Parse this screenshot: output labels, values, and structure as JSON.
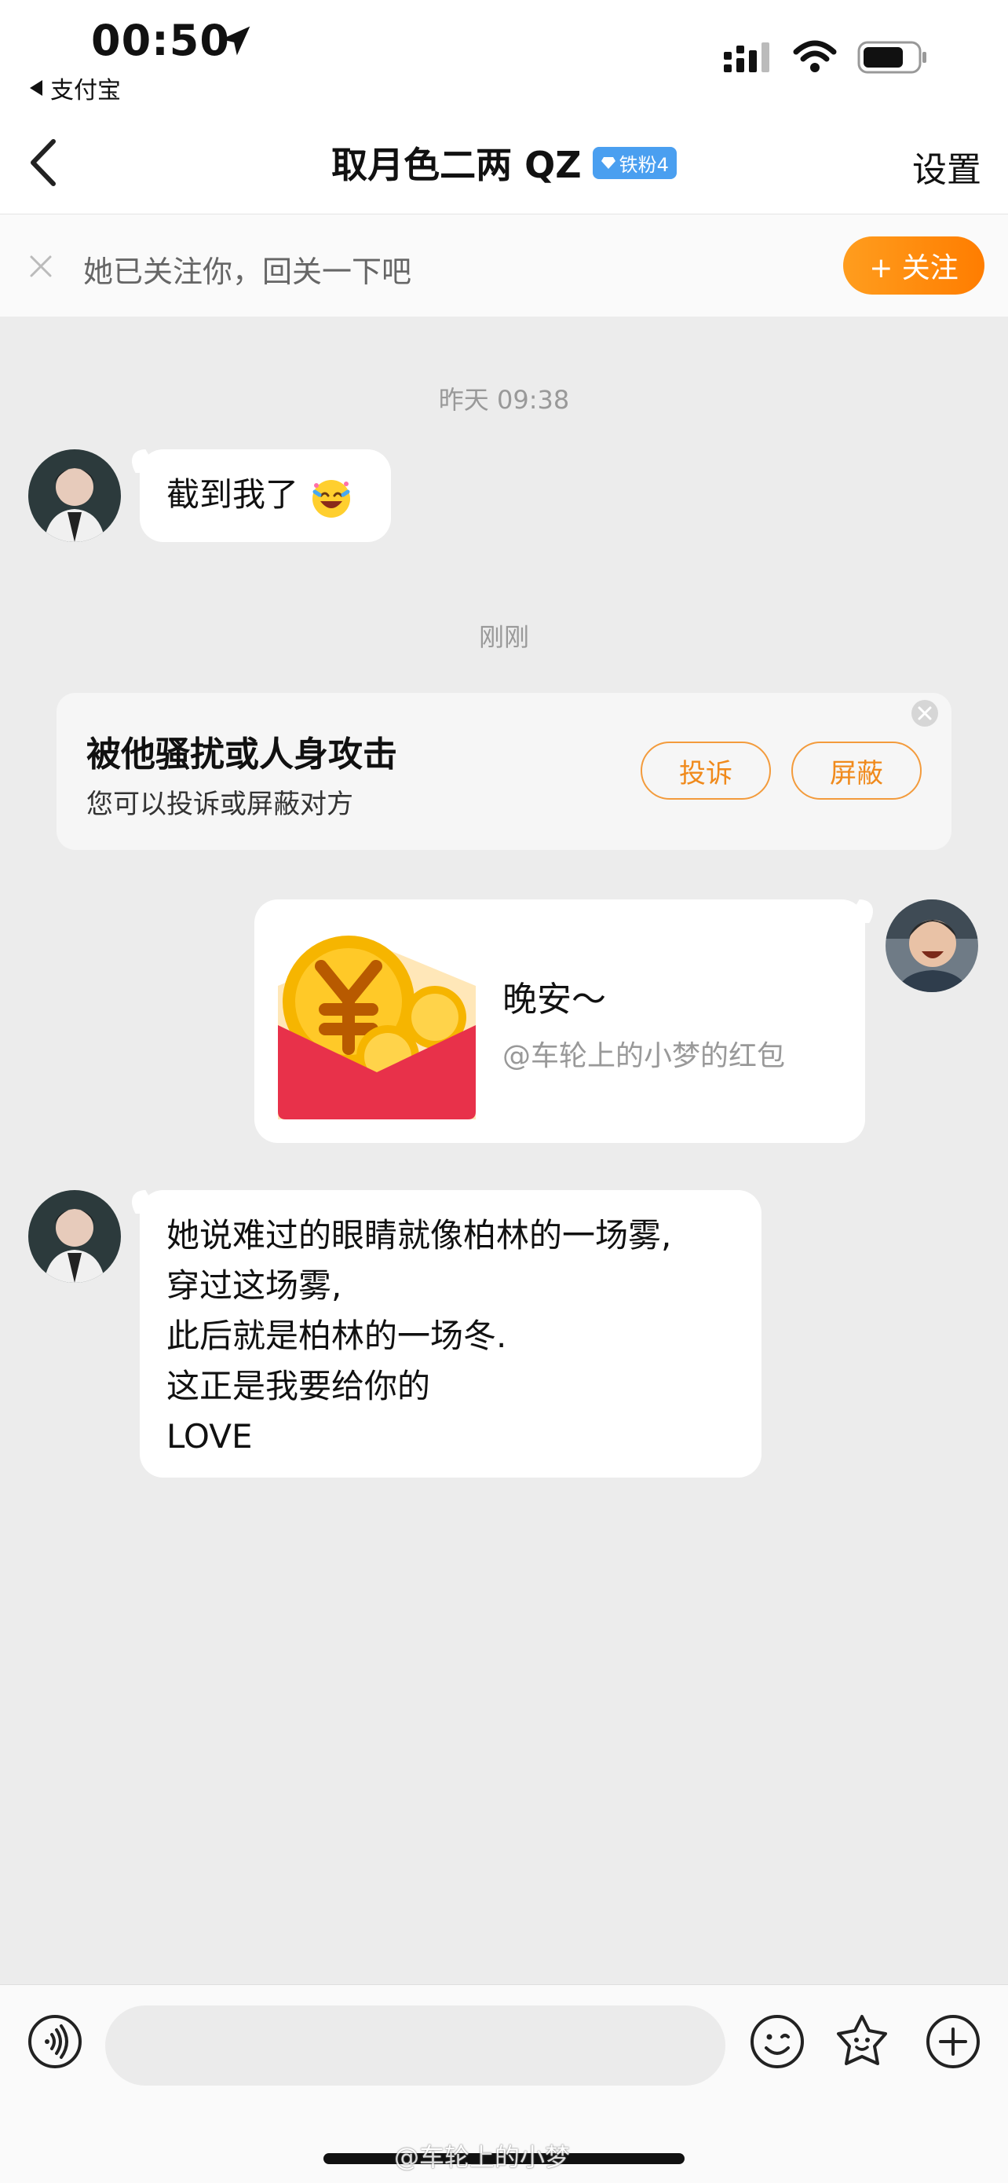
{
  "status": {
    "time": "00:50",
    "back_app": "支付宝"
  },
  "nav": {
    "title": "取月色二两 QZ",
    "fan_badge": "铁粉4",
    "settings": "设置"
  },
  "follow_banner": {
    "text": "她已关注你，回关一下吧",
    "button": "+ 关注"
  },
  "messages": {
    "ts1": "昨天 09:38",
    "msg1": "截到我了",
    "ts2": "刚刚",
    "report": {
      "title": "被他骚扰或人身攻击",
      "subtitle": "您可以投诉或屏蔽对方",
      "complain": "投诉",
      "block": "屏蔽"
    },
    "red_packet": {
      "title": "晚安～",
      "subtitle": "@车轮上的小梦的红包"
    },
    "msg3_lines": [
      "她说难过的眼睛就像柏林的一场雾,",
      "穿过这场雾,",
      "此后就是柏林的一场冬.",
      "这正是我要给你的",
      "LOVE"
    ]
  },
  "watermark": "@车轮上的小梦",
  "colors": {
    "accent_orange": "#ff8a0d",
    "chat_bg": "#ececec",
    "packet_red": "#e8314a",
    "badge_blue": "#4a9ff0"
  },
  "icons": [
    "location-arrow-icon",
    "signal-icon",
    "wifi-icon",
    "battery-icon",
    "back-chevron-icon",
    "diamond-icon",
    "close-icon",
    "voice-icon",
    "emoji-icon",
    "sticker-icon",
    "plus-icon"
  ]
}
